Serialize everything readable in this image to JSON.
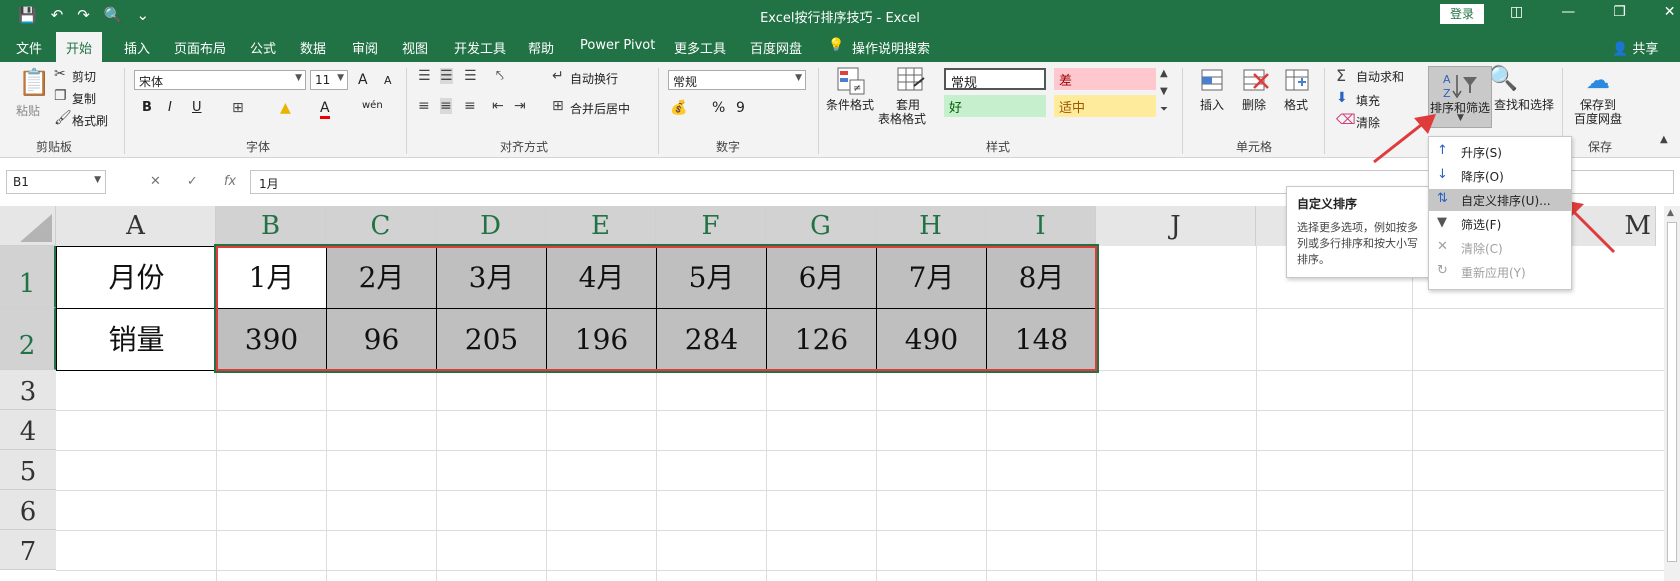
{
  "title_bar": {
    "title": "Excel按行排序技巧  -  Excel",
    "login": "登录",
    "qat_icons": [
      "save-icon",
      "undo-icon",
      "redo-icon",
      "print-preview-icon",
      "customize-icon"
    ]
  },
  "ribbon_tabs": [
    "文件",
    "开始",
    "插入",
    "页面布局",
    "公式",
    "数据",
    "审阅",
    "视图",
    "开发工具",
    "帮助",
    "Power Pivot",
    "更多工具",
    "百度网盘",
    "操作说明搜索"
  ],
  "share_label": "共享",
  "ribbon": {
    "clipboard": {
      "paste": "粘贴",
      "cut": "剪切",
      "copy": "复制",
      "format_painter": "格式刷",
      "label": "剪贴板"
    },
    "font": {
      "name": "宋体",
      "size": "11",
      "bold": "B",
      "italic": "I",
      "underline": "U",
      "font_color": "A",
      "wen": "wén",
      "label": "字体",
      "grow": "A",
      "shrink": "A"
    },
    "alignment": {
      "wrap": "自动换行",
      "merge": "合并后居中",
      "label": "对齐方式"
    },
    "number": {
      "format": "常规",
      "percent": "%",
      "comma": "9",
      "label": "数字"
    },
    "styles": {
      "conditional": "条件格式",
      "table_line1": "套用",
      "table_line2": "表格格式",
      "normal": "常规",
      "bad": "差",
      "good": "好",
      "neutral": "适中",
      "label": "样式"
    },
    "cells": {
      "insert": "插入",
      "delete": "删除",
      "format": "格式",
      "label": "单元格"
    },
    "editing": {
      "autosum": "自动求和",
      "fill": "填充",
      "clear": "清除",
      "sort_filter": "排序和筛选",
      "find_select": "查找和选择"
    },
    "save": {
      "line1": "保存到",
      "line2": "百度网盘",
      "label": "保存"
    }
  },
  "formula_bar": {
    "name_box": "B1",
    "fx": "fx",
    "value": "1月"
  },
  "columns": [
    "A",
    "B",
    "C",
    "D",
    "E",
    "F",
    "G",
    "H",
    "I",
    "J",
    "M"
  ],
  "rows": [
    "1",
    "2",
    "3",
    "4",
    "5",
    "6",
    "7"
  ],
  "table": {
    "row1_label": "月份",
    "row2_label": "销量",
    "months": [
      "1月",
      "2月",
      "3月",
      "4月",
      "5月",
      "6月",
      "7月",
      "8月"
    ],
    "sales": [
      "390",
      "96",
      "205",
      "196",
      "284",
      "126",
      "490",
      "148"
    ]
  },
  "tooltip": {
    "title": "自定义排序",
    "body": "选择更多选项，例如按多列或多行排序和按大小写排序。"
  },
  "sort_menu": [
    {
      "label": "升序(S)",
      "icon": "sort-asc-icon",
      "enabled": true
    },
    {
      "label": "降序(O)",
      "icon": "sort-desc-icon",
      "enabled": true
    },
    {
      "label": "自定义排序(U)...",
      "icon": "custom-sort-icon",
      "enabled": true,
      "highlighted": true
    },
    {
      "label": "筛选(F)",
      "icon": "filter-icon",
      "enabled": true
    },
    {
      "label": "清除(C)",
      "icon": "clear-filter-icon",
      "enabled": false
    },
    {
      "label": "重新应用(Y)",
      "icon": "reapply-icon",
      "enabled": false
    }
  ],
  "colors": {
    "excel_green": "#217346",
    "cell_gray": "#bfbfbf",
    "highlight_red": "#e03b3b"
  }
}
